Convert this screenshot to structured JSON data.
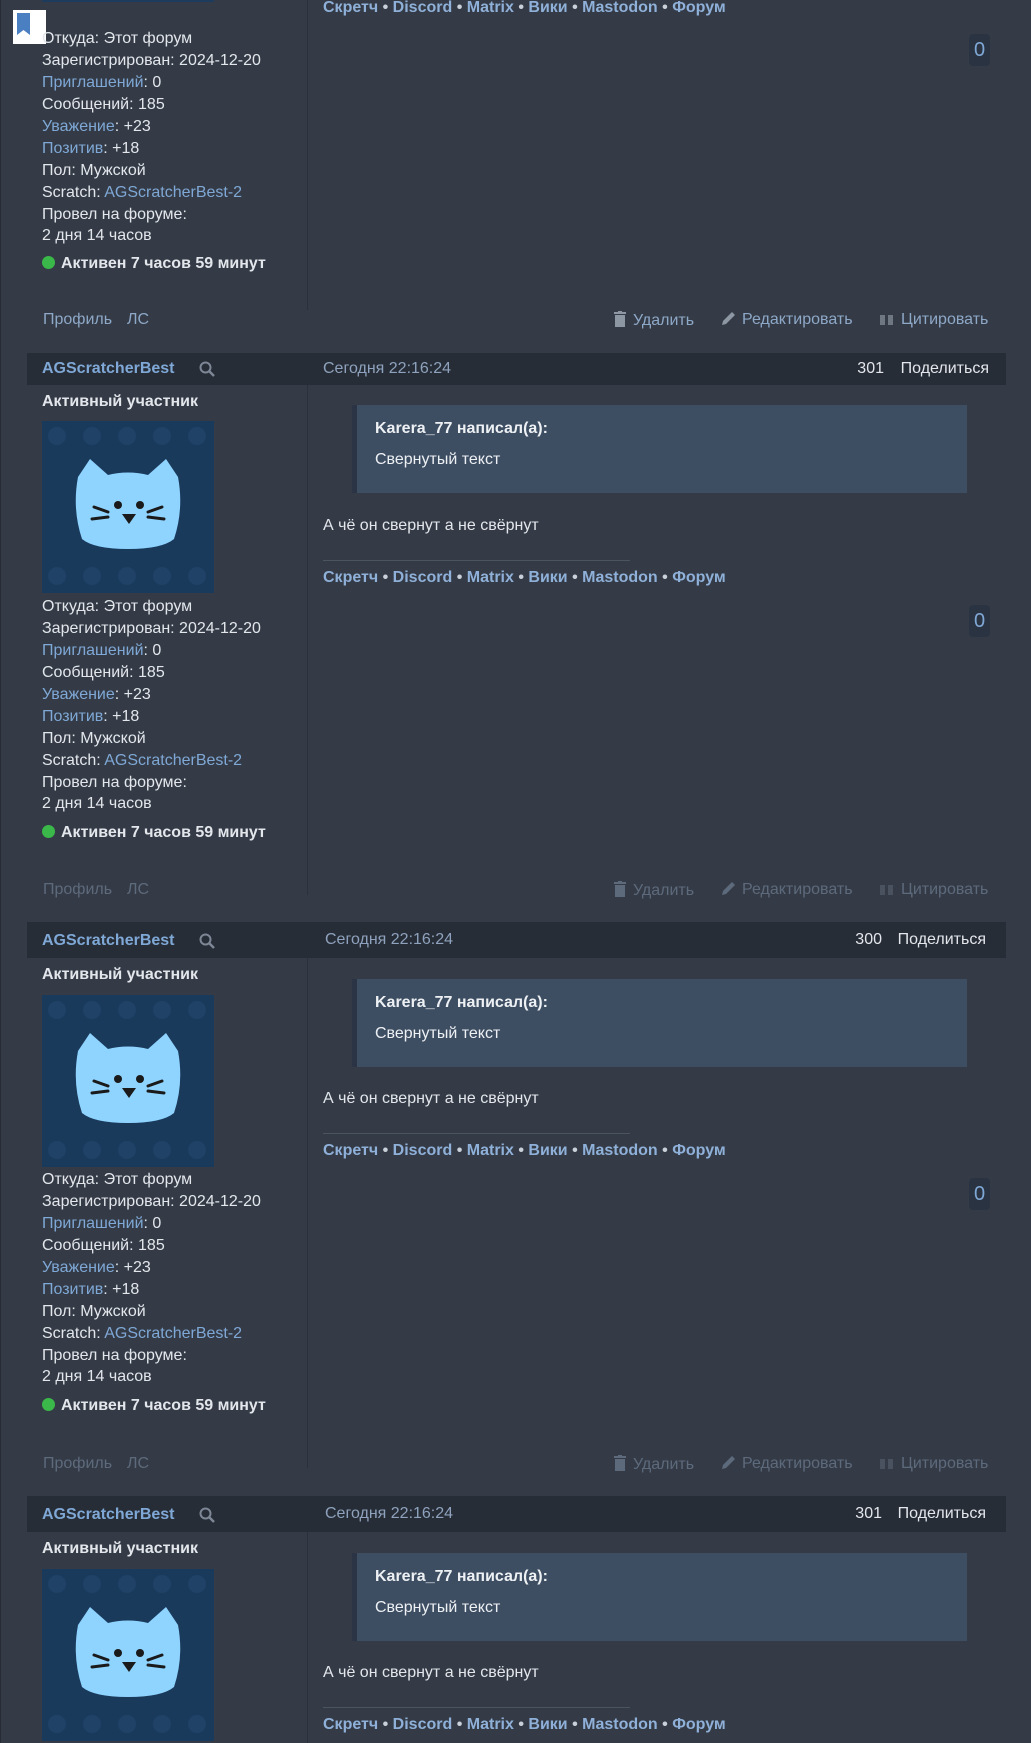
{
  "posts_meta": {
    "share_label": "Поделиться",
    "rank": "Активный участник",
    "search_icon": "search-icon"
  },
  "posts": [
    {
      "author": "AGScratcherBest",
      "date": "Сегодня 22:16:24",
      "num": "301"
    },
    {
      "author": "AGScratcherBest",
      "date": "Сегодня 22:16:24",
      "num": "300"
    },
    {
      "author": "AGScratcherBest",
      "date": "Сегодня 22:16:24",
      "num": "301"
    }
  ],
  "profile": {
    "from_label": "Откуда:",
    "from_value": "Этот форум",
    "registered_label": "Зарегистрирован:",
    "registered_value": "2024-12-20",
    "invites_label": "Приглашений",
    "invites_value": ": 0",
    "messages_label": "Сообщений:",
    "messages_value": "185",
    "respect_label": "Уважение",
    "respect_value": ": +23",
    "positive_label": "Позитив",
    "positive_value": ": +18",
    "gender_label": "Пол:",
    "gender_value": "Мужской",
    "scratch_label": "Scratch:",
    "scratch_value": "AGScratcherBest-2",
    "time_label": "Провел на форуме:",
    "time_value": "2 дня 14 часов",
    "active_text": "Активен 7 часов 59 минут"
  },
  "post_body": {
    "quote_author": "Karera_77 написал(а):",
    "quote_text": "Свернутый текст",
    "text": "А чё он свернут а не свёрнут"
  },
  "signature": {
    "links": [
      "Скретч",
      "Discord",
      "Matrix",
      "Вики",
      "Mastodon",
      "Форум"
    ],
    "sep": "•"
  },
  "badge_value": "0",
  "footer": {
    "profile": "Профиль",
    "pm": "ЛС",
    "delete": "Удалить",
    "edit": "Редактировать",
    "quote": "Цитировать"
  },
  "colors": {
    "background": "#343b46",
    "header": "#272d37",
    "link": "#7fa8d6",
    "quote_bg": "#3d4d62",
    "online": "#3bb84a"
  }
}
